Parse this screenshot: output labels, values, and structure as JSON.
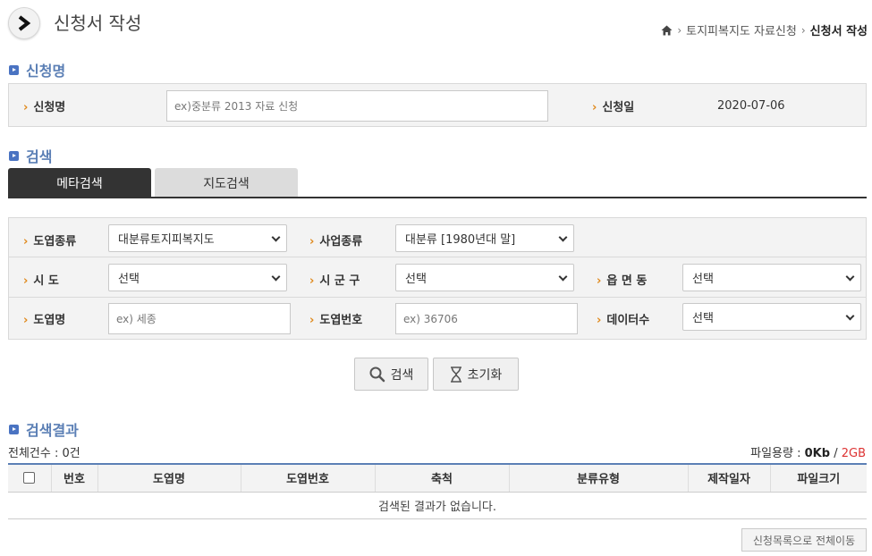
{
  "header": {
    "title": "신청서 작성",
    "breadcrumb": [
      "토지피복지도 자료신청",
      "신청서 작성"
    ]
  },
  "apply_section": {
    "title": "신청명",
    "name_label": "신청명",
    "name_placeholder": "ex)중분류 2013 자료 신청",
    "date_label": "신청일",
    "date_value": "2020-07-06"
  },
  "search_section": {
    "title": "검색",
    "tabs": [
      "메타검색",
      "지도검색"
    ],
    "fields": {
      "map_type": {
        "label": "도엽종류",
        "value": "대분류토지피복지도"
      },
      "project_type": {
        "label": "사업종류",
        "value": "대분류 [1980년대 말]"
      },
      "sido": {
        "label": "시 도",
        "value": "선택"
      },
      "sigungu": {
        "label": "시 군 구",
        "value": "선택"
      },
      "eupmyeondong": {
        "label": "읍 면 동",
        "value": "선택"
      },
      "map_name": {
        "label": "도엽명",
        "placeholder": "ex) 세종"
      },
      "map_number": {
        "label": "도엽번호",
        "placeholder": "ex) 36706"
      },
      "data_count": {
        "label": "데이터수",
        "value": "선택"
      }
    },
    "search_button": "검색",
    "reset_button": "초기화"
  },
  "results_section": {
    "title": "검색결과",
    "total_count": "전체건수 : 0건",
    "file_size_label": "파일용량 : ",
    "file_size_value": "0Kb",
    "file_size_sep": " / ",
    "file_size_max": "2GB",
    "columns": [
      "번호",
      "도엽명",
      "도엽번호",
      "축척",
      "분류유형",
      "제작일자",
      "파일크기"
    ],
    "empty_message": "검색된 결과가 없습니다.",
    "move_all_button": "신청목록으로 전체이동"
  },
  "colors": {
    "accent": "#5b7fb5",
    "label_arrow": "#e08a1e",
    "active_tab": "#333333",
    "limit_red": "#dd3333"
  }
}
